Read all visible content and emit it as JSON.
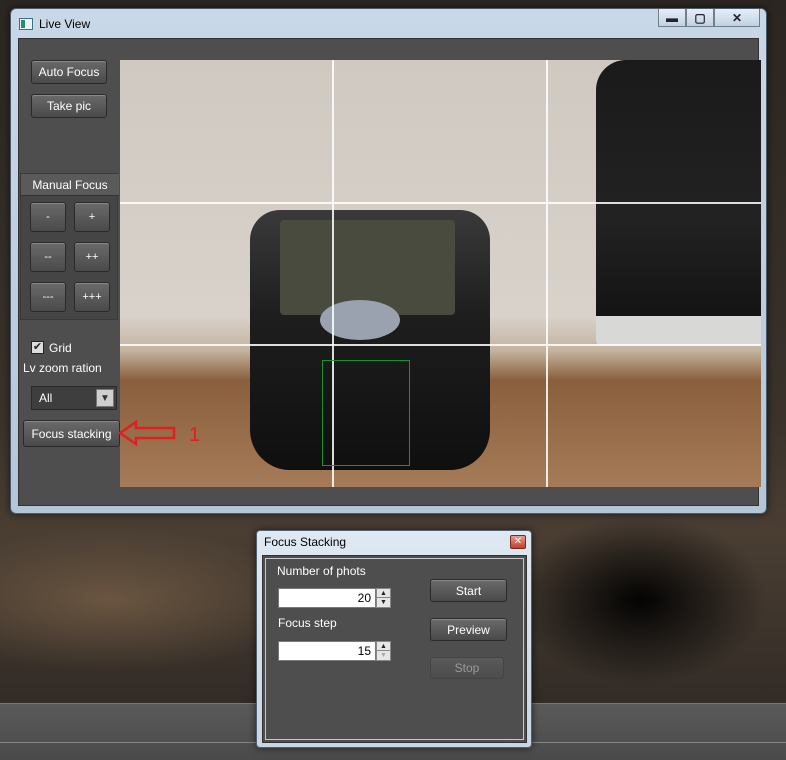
{
  "live_view": {
    "title": "Live View",
    "window_buttons": {
      "minimize": "▬",
      "maximize": "▢",
      "close": "✕"
    },
    "auto_focus_label": "Auto Focus",
    "take_pic_label": "Take pic",
    "manual_focus": {
      "header": "Manual Focus",
      "buttons": [
        "-",
        "+",
        "--",
        "++",
        "---",
        "+++"
      ]
    },
    "grid": {
      "label": "Grid",
      "checked": true
    },
    "zoom": {
      "label": "Lv zoom ration",
      "value": "All"
    },
    "focus_stacking_label": "Focus stacking"
  },
  "annotation": {
    "number": "1",
    "color": "#e02020"
  },
  "focus_stacking_dialog": {
    "title": "Focus Stacking",
    "close_glyph": "✕",
    "photos_label": "Number of phots",
    "photos_value": "20",
    "step_label": "Focus step",
    "step_value": "15",
    "start_label": "Start",
    "preview_label": "Preview",
    "stop_label": "Stop"
  },
  "colors": {
    "panel": "#4e4e4e",
    "button": "#5a5a5a",
    "focus_rect": "#1f8f2f",
    "title_bar": "#c9d8e6"
  }
}
